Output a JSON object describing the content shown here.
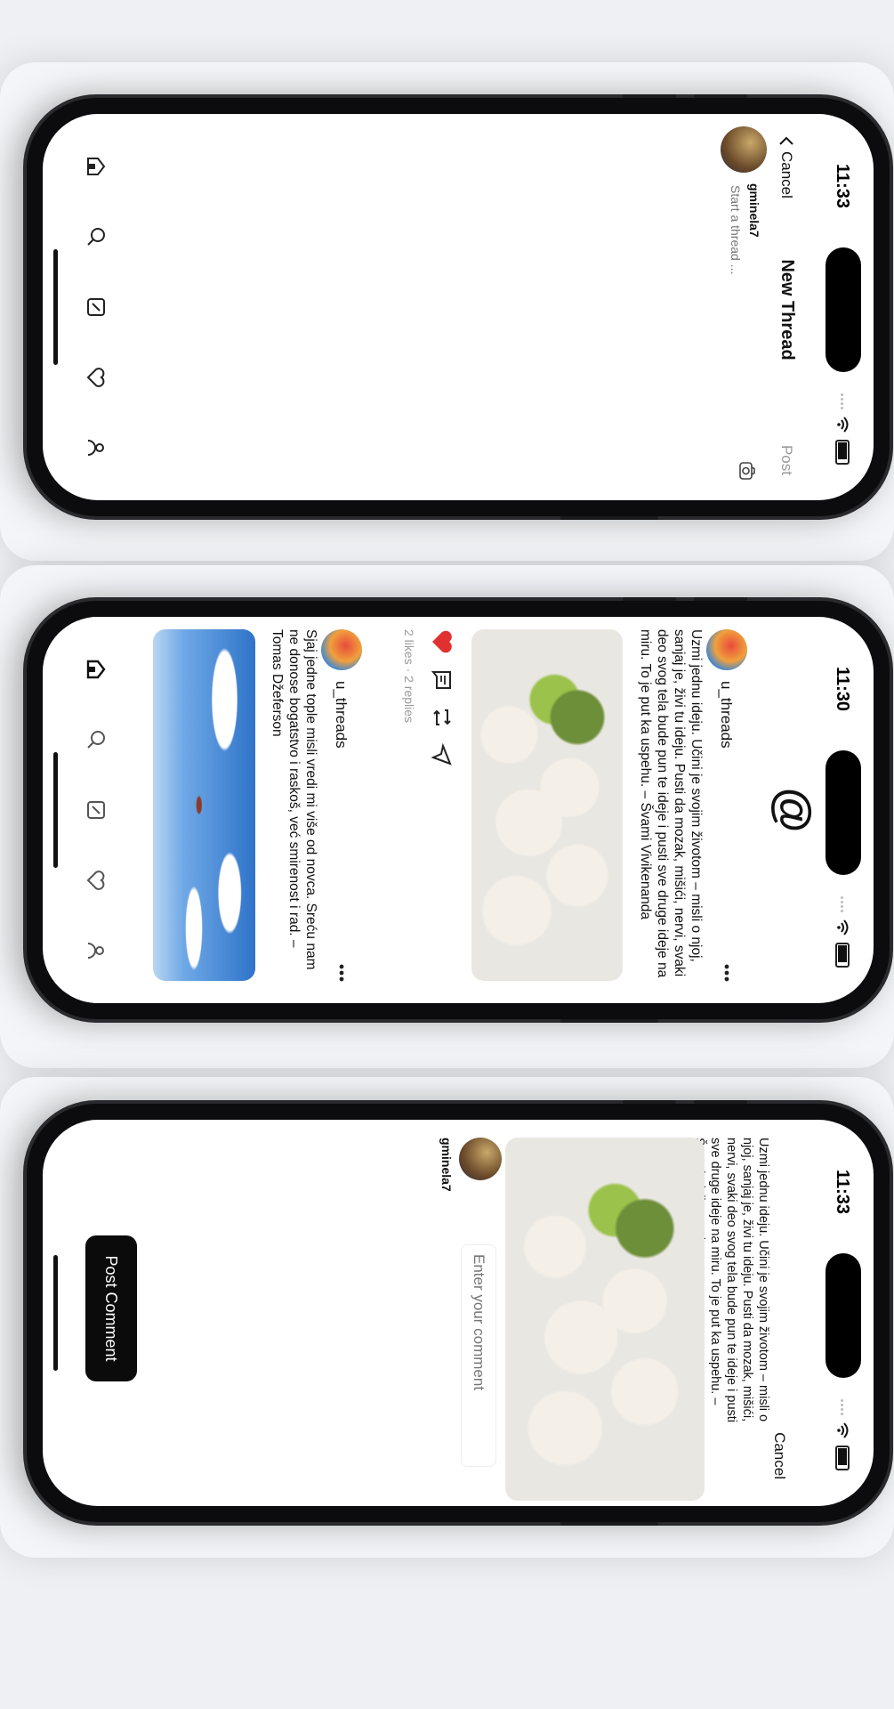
{
  "phone_new_thread": {
    "time": "11:33",
    "cancel": "Cancel",
    "title": "New Thread",
    "post": "Post",
    "username": "gminela7",
    "placeholder": "Start a thread ..."
  },
  "phone_feed": {
    "time": "11:30",
    "logo": "@",
    "post1": {
      "username": "u_threads",
      "text": "Uzmi jednu ideju. Učini je svojim životom – misli o njoj, sanjaj je, živi tu ideju. Pusti da mozak, mišići, nervi, svaki deo svog tela bude pun te ideje i pusti sve druge ideje na miru. To je put ka uspehu. – Švami Vivikenanda",
      "stats": "2 likes · 2 replies"
    },
    "post2": {
      "username": "u_threads",
      "text": "Sjaj jedne tople misli vredi mi više od novca. Sreću nam ne donose bogatstvo i raskoš, već smirenost i rad. – Tomas Džeferson"
    }
  },
  "phone_comment": {
    "time": "11:33",
    "cancel": "Cancel",
    "text": "Uzmi jednu ideju. Učini je svojim životom – misli o njoj, sanjaj je, živi tu ideju. Pusti da mozak, mišići, nervi, svaki deo svog tela bude pun te ideje i pusti sve druge ideje na miru. To je put ka uspehu. – Švami Vivikenanda",
    "username": "gminela7",
    "placeholder": "Enter your comment",
    "button": "Post Comment"
  },
  "tabbar_icons": [
    "home-icon",
    "search-icon",
    "compose-icon",
    "heart-icon",
    "profile-icon"
  ]
}
